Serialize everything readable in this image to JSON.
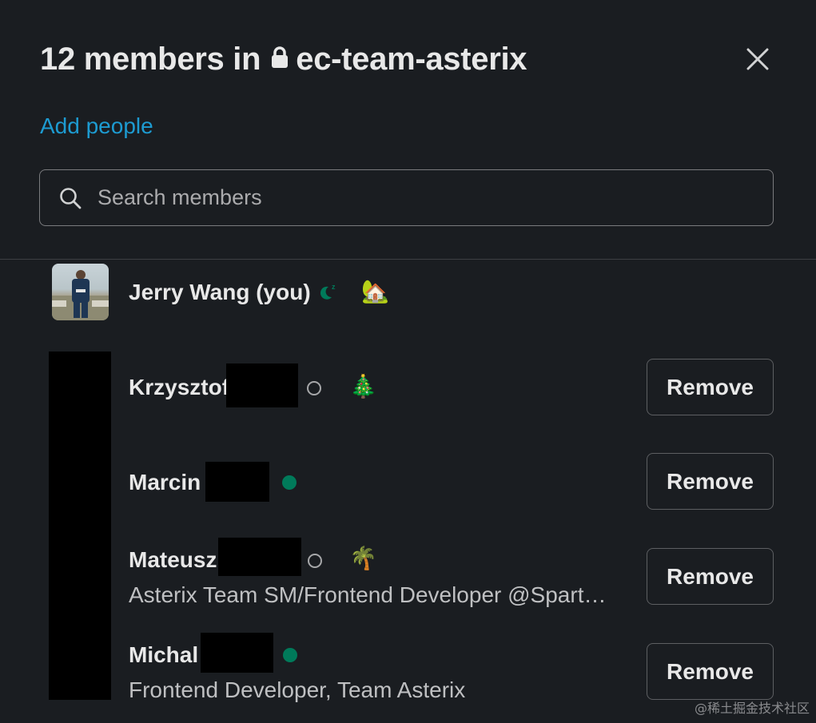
{
  "dialog": {
    "title_prefix": "12 members in",
    "channel_name": "ec-team-asterix",
    "add_people_label": "Add people",
    "search_placeholder": "Search members"
  },
  "members": [
    {
      "name": "Jerry Wang (you)",
      "status": "away-dnd",
      "emoji": "🏡"
    },
    {
      "name": "Krzysztof",
      "status": "away",
      "emoji": "🎄",
      "remove_label": "Remove"
    },
    {
      "name": "Marcin",
      "status": "online",
      "remove_label": "Remove"
    },
    {
      "name": "Mateusz",
      "status": "away",
      "emoji": "🌴",
      "subtitle": "Asterix Team SM/Frontend Developer @Spart…",
      "remove_label": "Remove"
    },
    {
      "name": "Michal",
      "status": "online",
      "subtitle": "Frontend Developer, Team Asterix",
      "remove_label": "Remove"
    }
  ],
  "watermark": "@稀土掘金技术社区",
  "colors": {
    "background": "#1a1d21",
    "link": "#1d9bd1",
    "online": "#007a5a",
    "text": "#e8e8e8"
  }
}
